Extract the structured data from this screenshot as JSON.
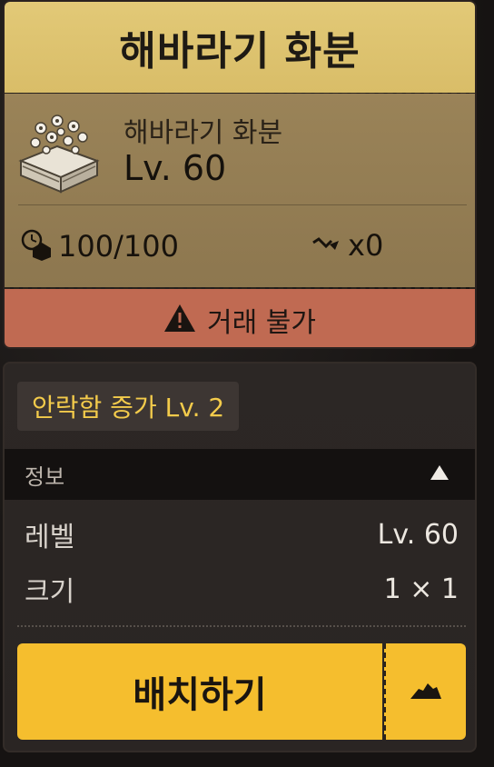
{
  "item": {
    "title": "해바라기 화분",
    "name": "해바라기 화분",
    "level": "Lv. 60",
    "durability": "100/100",
    "repair_count": "x0",
    "trade_status": "거래 불가"
  },
  "details": {
    "buff": "안락함 증가 Lv. 2",
    "section_title": "정보",
    "rows": [
      {
        "key": "레벨",
        "value": "Lv. 60"
      },
      {
        "key": "크기",
        "value": "1 × 1"
      }
    ]
  },
  "actions": {
    "place_label": "배치하기"
  },
  "icons": {
    "item": "flower-pot-icon",
    "durability": "durability-icon",
    "repair": "repair-icon",
    "warning": "warning-icon",
    "collapse": "triangle-up-icon",
    "expand": "mound-icon"
  },
  "colors": {
    "title_bg": "#e2c977",
    "info_bg": "#9a8358",
    "trade_bg": "#c06a52",
    "buff_text": "#f3cb4b",
    "button_bg": "#f5be2e"
  }
}
